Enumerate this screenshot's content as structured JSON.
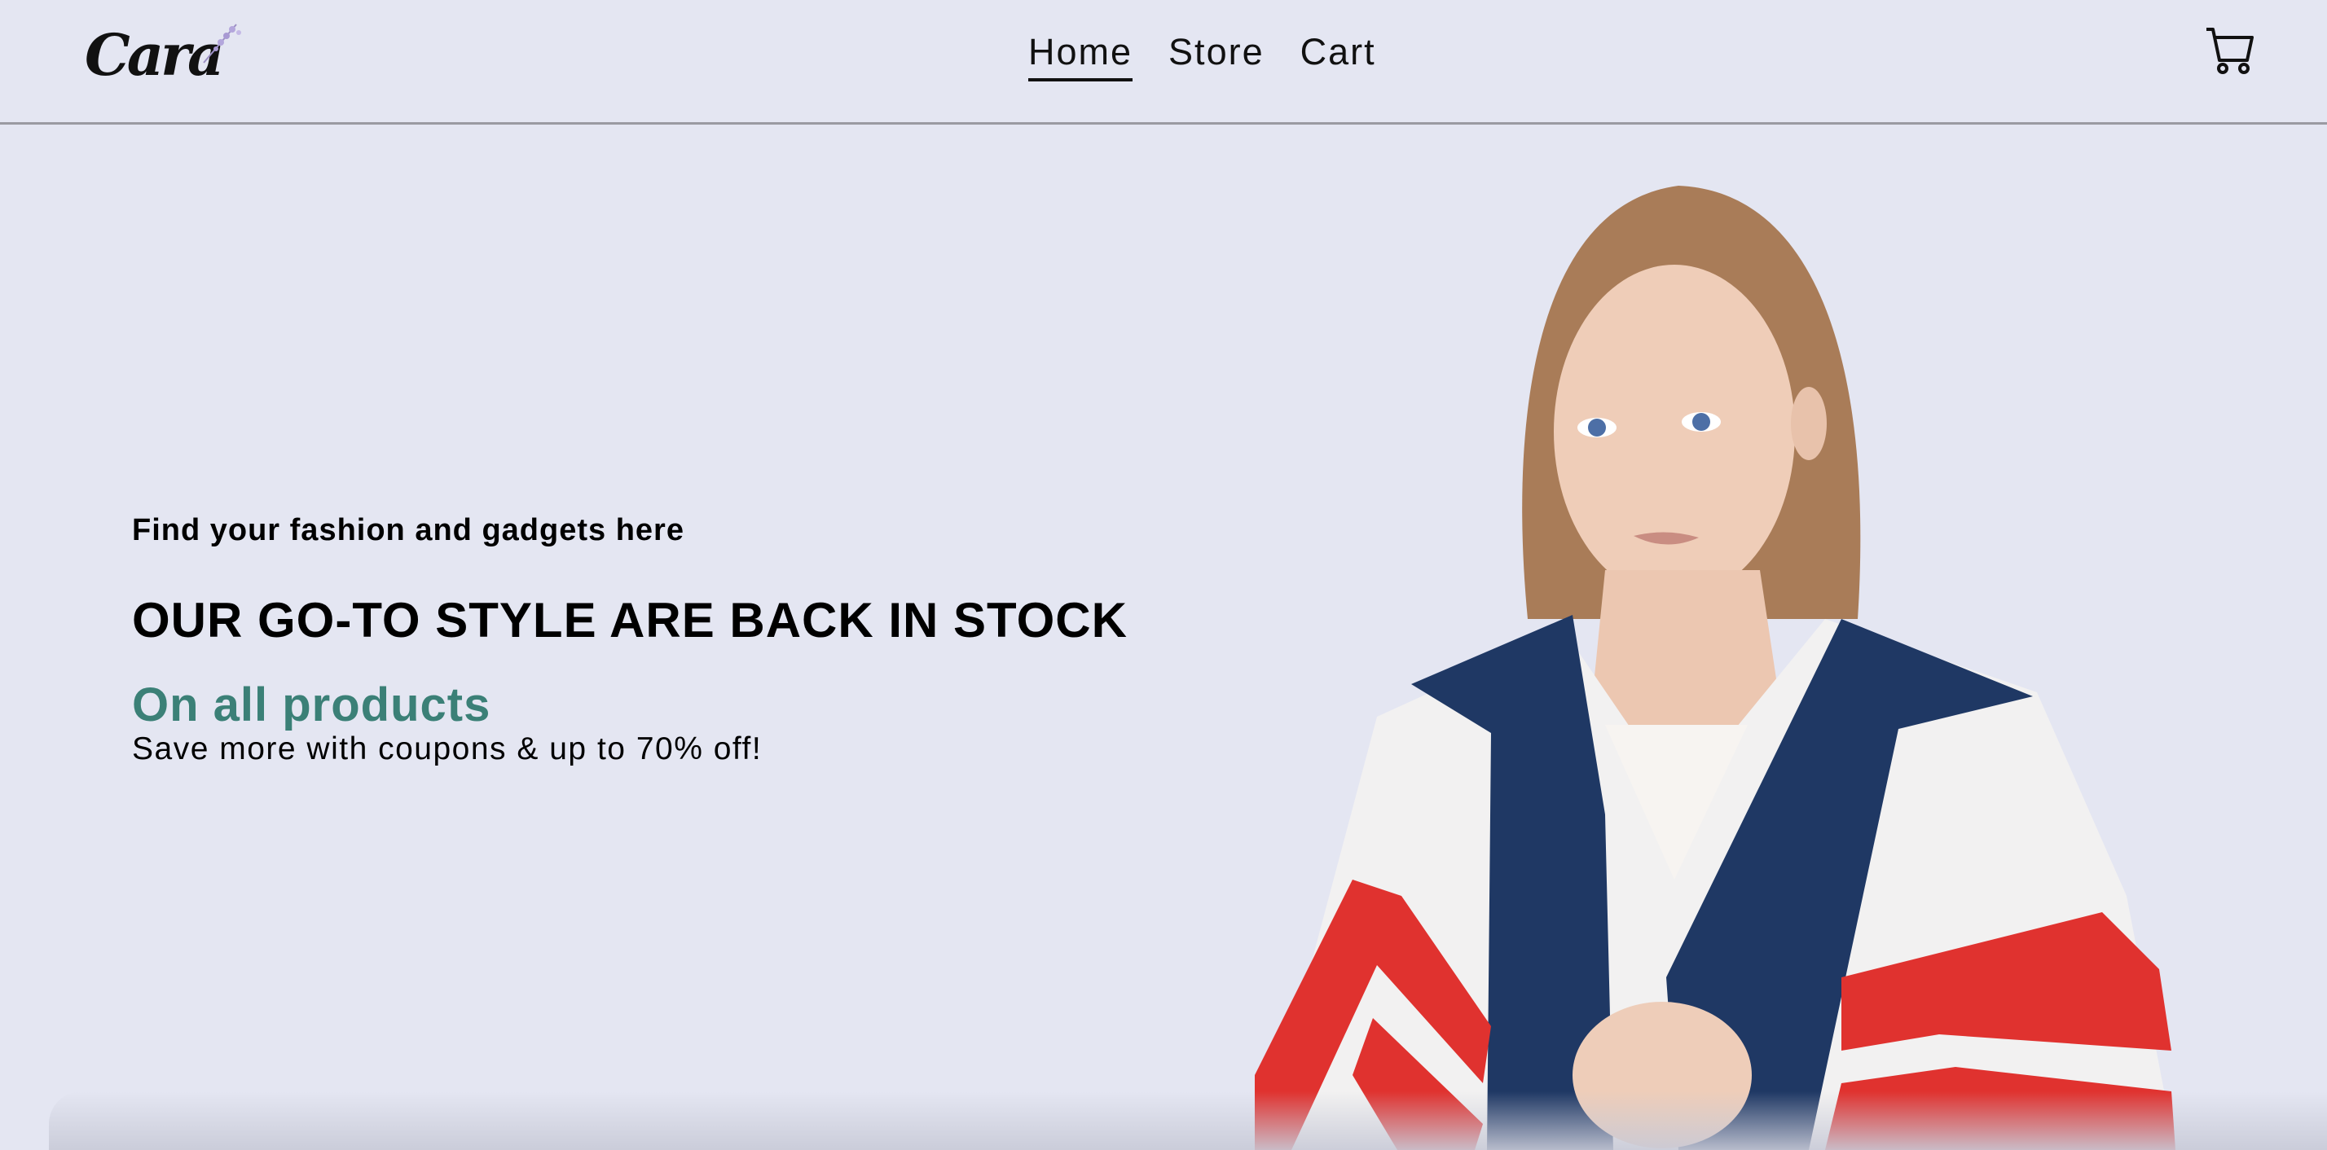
{
  "header": {
    "logo_text": "Cara",
    "nav": [
      {
        "label": "Home",
        "active": true
      },
      {
        "label": "Store",
        "active": false
      },
      {
        "label": "Cart",
        "active": false
      }
    ],
    "cart_icon": "shopping-cart-icon"
  },
  "hero": {
    "subtitle": "Find your fashion and gadgets here",
    "headline": "OUR GO-TO STYLE ARE BACK IN STOCK",
    "offer": "On all products",
    "description": "Save more with coupons & up to 70% off!",
    "image": "model-in-track-jacket"
  },
  "colors": {
    "background": "#e4e6f2",
    "accent": "#3b8077",
    "divider": "#9a9aa2"
  }
}
